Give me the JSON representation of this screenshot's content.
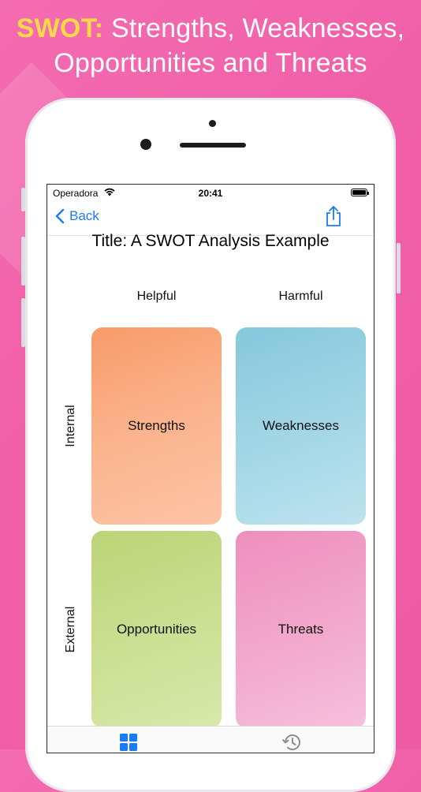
{
  "headline": {
    "accent": "SWOT:",
    "line1": "Strengths, Weaknesses,",
    "line2": "Opportunities and Threats"
  },
  "status": {
    "carrier": "Operadora",
    "time": "20:41"
  },
  "nav": {
    "back_label": "Back"
  },
  "page": {
    "title": "Title: A SWOT Analysis Example"
  },
  "matrix": {
    "columns": [
      "Helpful",
      "Harmful"
    ],
    "rows": [
      "Internal",
      "External"
    ],
    "cells": [
      "Strengths",
      "Weaknesses",
      "Opportunities",
      "Threats"
    ]
  },
  "colors": {
    "accent": "#ffd84a",
    "background": "#f060a8",
    "link": "#1a7bf2"
  },
  "icons": {
    "back": "chevron-left-icon",
    "share": "share-icon",
    "grid_tab": "grid-icon",
    "history_tab": "history-icon"
  }
}
